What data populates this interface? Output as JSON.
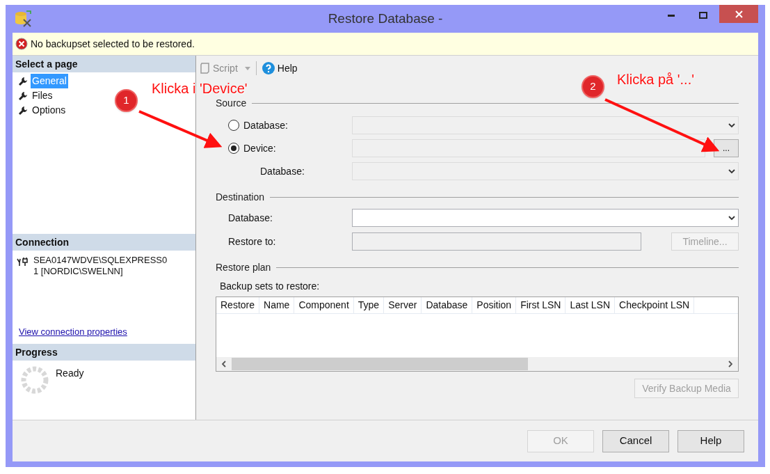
{
  "window": {
    "title": "Restore Database -"
  },
  "alert": {
    "message": "No backupset selected to be restored."
  },
  "sidebar": {
    "select_page": {
      "header": "Select a page",
      "pages": [
        {
          "label": "General",
          "selected": true
        },
        {
          "label": "Files",
          "selected": false
        },
        {
          "label": "Options",
          "selected": false
        }
      ]
    },
    "connection": {
      "header": "Connection",
      "server": "SEA0147WDVE\\SQLEXPRESS01 [NORDIC\\SWELNN]",
      "link": "View connection properties"
    },
    "progress": {
      "header": "Progress",
      "status": "Ready"
    }
  },
  "toolbar": {
    "script": "Script",
    "help": "Help"
  },
  "source": {
    "legend": "Source",
    "options": [
      {
        "label": "Database:",
        "selected": false
      },
      {
        "label": "Device:",
        "selected": true
      }
    ],
    "browse_button": "...",
    "database_label": "Database:"
  },
  "destination": {
    "legend": "Destination",
    "database_label": "Database:",
    "restore_to_label": "Restore to:",
    "timeline_button": {
      "label": "Timeline...",
      "disabled": true
    }
  },
  "restore_plan": {
    "legend": "Restore plan",
    "backup_sets_label": "Backup sets to restore:",
    "columns": [
      "Restore",
      "Name",
      "Component",
      "Type",
      "Server",
      "Database",
      "Position",
      "First LSN",
      "Last LSN",
      "Checkpoint LSN"
    ],
    "verify_button": {
      "label": "Verify Backup Media",
      "disabled": true
    }
  },
  "buttons": [
    {
      "label": "OK",
      "disabled": true
    },
    {
      "label": "Cancel",
      "disabled": false
    },
    {
      "label": "Help",
      "disabled": false
    }
  ],
  "annotations": [
    {
      "number": "1",
      "text": "Klicka i 'Device'"
    },
    {
      "number": "2",
      "text": "Klicka på '...'"
    }
  ]
}
